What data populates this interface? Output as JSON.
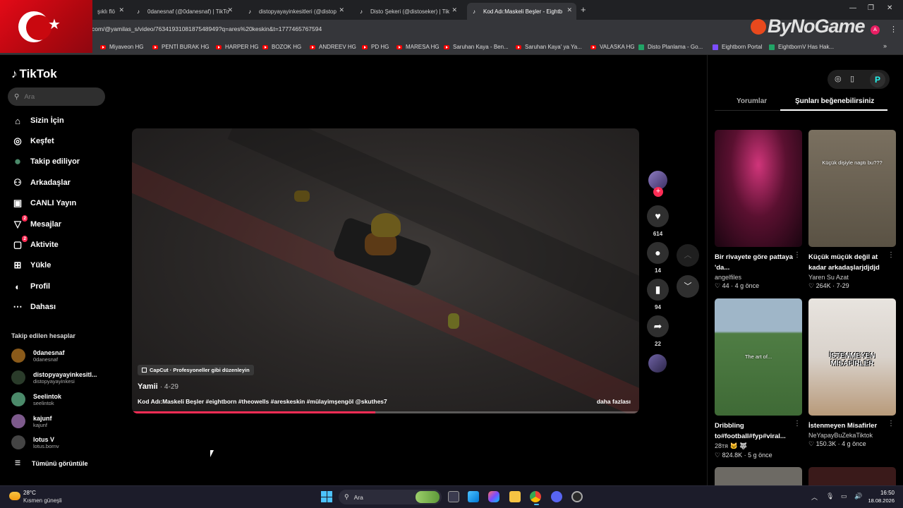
{
  "browser": {
    "tabs": [
      {
        "title": "şıklı flö",
        "active": false
      },
      {
        "title": "0danesnaf (@0danesnaf) | TikTo",
        "active": false
      },
      {
        "title": "distopyayayinkesitleri (@distop",
        "active": false
      },
      {
        "title": "Disto Şekeri (@distoseker) | Tik",
        "active": false
      },
      {
        "title": "Kod Adı:Maskeli Beşler - Eightb",
        "active": true
      }
    ],
    "new_tab": "+",
    "url": "com/@yamilas_s/video/7634193108187548949?q=ares%20keskin&t=1777465767594",
    "profile_initial": "A",
    "bookmarks": [
      {
        "label": "Miyaveon HG",
        "type": "yt"
      },
      {
        "label": "PENTİ BURAK HG",
        "type": "yt"
      },
      {
        "label": "HARPER HG",
        "type": "yt"
      },
      {
        "label": "BOZOK HG",
        "type": "yt"
      },
      {
        "label": "ANDREEV HG",
        "type": "yt"
      },
      {
        "label": "PD HG",
        "type": "yt"
      },
      {
        "label": "MARESA HG",
        "type": "yt"
      },
      {
        "label": "Saruhan Kaya - Ben...",
        "type": "yt"
      },
      {
        "label": "Saruhan Kaya' ya Ya...",
        "type": "yt"
      },
      {
        "label": "VALASKA HG",
        "type": "yt"
      },
      {
        "label": "Disto Planlama - Go...",
        "type": "sheet"
      },
      {
        "label": "Eightborn Portal",
        "type": "eb"
      },
      {
        "label": "EightbornV Has Hak...",
        "type": "sheet"
      }
    ],
    "more_bookmarks": "»"
  },
  "watermark": "ByNoGame",
  "tiktok": {
    "logo": "TikTok",
    "search_placeholder": "Ara",
    "nav": [
      {
        "label": "Sizin İçin",
        "icon": "home-icon",
        "glyph": "⌂",
        "badge": ""
      },
      {
        "label": "Keşfet",
        "icon": "compass-icon",
        "glyph": "◎",
        "badge": ""
      },
      {
        "label": "Takip ediliyor",
        "icon": "following-avatar-icon",
        "glyph": "●",
        "badge": ""
      },
      {
        "label": "Arkadaşlar",
        "icon": "friends-icon",
        "glyph": "⚇",
        "badge": ""
      },
      {
        "label": "CANLI Yayın",
        "icon": "live-icon",
        "glyph": "▣",
        "badge": ""
      },
      {
        "label": "Mesajlar",
        "icon": "messages-icon",
        "glyph": "▽",
        "badge": "2"
      },
      {
        "label": "Aktivite",
        "icon": "activity-icon",
        "glyph": "▢",
        "badge": "2"
      },
      {
        "label": "Yükle",
        "icon": "upload-icon",
        "glyph": "⊞",
        "badge": ""
      },
      {
        "label": "Profil",
        "icon": "profile-icon",
        "glyph": "◐",
        "badge": ""
      },
      {
        "label": "Dahası",
        "icon": "more-icon",
        "glyph": "⋯",
        "badge": ""
      }
    ],
    "followed_title": "Takip edilen hesaplar",
    "followed": [
      {
        "name": "0danesnaf",
        "handle": "0danesnaf",
        "color": "#8a5a1a"
      },
      {
        "name": "distopyayayinkesitl...",
        "handle": "distopyayayinkesi",
        "color": "#2a3b2a"
      },
      {
        "name": "Seelintok",
        "handle": "seelintok",
        "color": "#4b8a6a"
      },
      {
        "name": "kajunf",
        "handle": "kajunf",
        "color": "#7d5a8c"
      },
      {
        "name": "lotus V",
        "handle": "lotus.bornv",
        "color": "#444444"
      }
    ],
    "see_all": "Tümünü görüntüle"
  },
  "video": {
    "capcut_label": "CapCut · Profesyoneller gibi düzenleyin",
    "author": "Yamii",
    "date": "· 4-29",
    "description": "Kod Adı:Maskeli Beşler #eightborn #theowells #areskeskin #mülayimşengöl @skuthes7",
    "more_label": "daha fazlası",
    "progress": 0.48
  },
  "actions": {
    "likes": "614",
    "comments": "14",
    "saves": "94",
    "shares": "22"
  },
  "right_panel": {
    "tab_comments": "Yorumlar",
    "tab_suggested": "Şunları beğenebilirsiniz",
    "cards": [
      {
        "title": "Bir rivayete göre pattaya 'da...",
        "author": "angelfiles",
        "likes": "44",
        "age": "4 g önce",
        "overlay": "",
        "bg": "#2a0a1a"
      },
      {
        "title": "Küçük müçük değil at kadar arkadaşlarjdjdjd",
        "author": "Yaren Su Azat",
        "likes": "264K",
        "age": "7-29",
        "overlay": "Küçük dişiyle naptı bu???",
        "bg": "#6b6152"
      },
      {
        "title": "Dribbling to#football#fyp#viral...",
        "author": "28тя 🐱 🐺",
        "likes": "824.8K",
        "age": "5 g önce",
        "overlay": "The art of...",
        "bg": "#4d7a4a"
      },
      {
        "title": "İstenmeyen Misafirler",
        "author": "NeYapayBuZekaTiktok",
        "likes": "150.3K",
        "age": "4 g önce",
        "overlay": "İSTENMEYEN MİSAFİRLER",
        "bg": "#c9c4be"
      }
    ]
  },
  "taskbar": {
    "temperature": "28°C",
    "weather": "Kısmen güneşli",
    "search_label": "Ara",
    "time": "16:50",
    "date": "18.08.2026"
  }
}
